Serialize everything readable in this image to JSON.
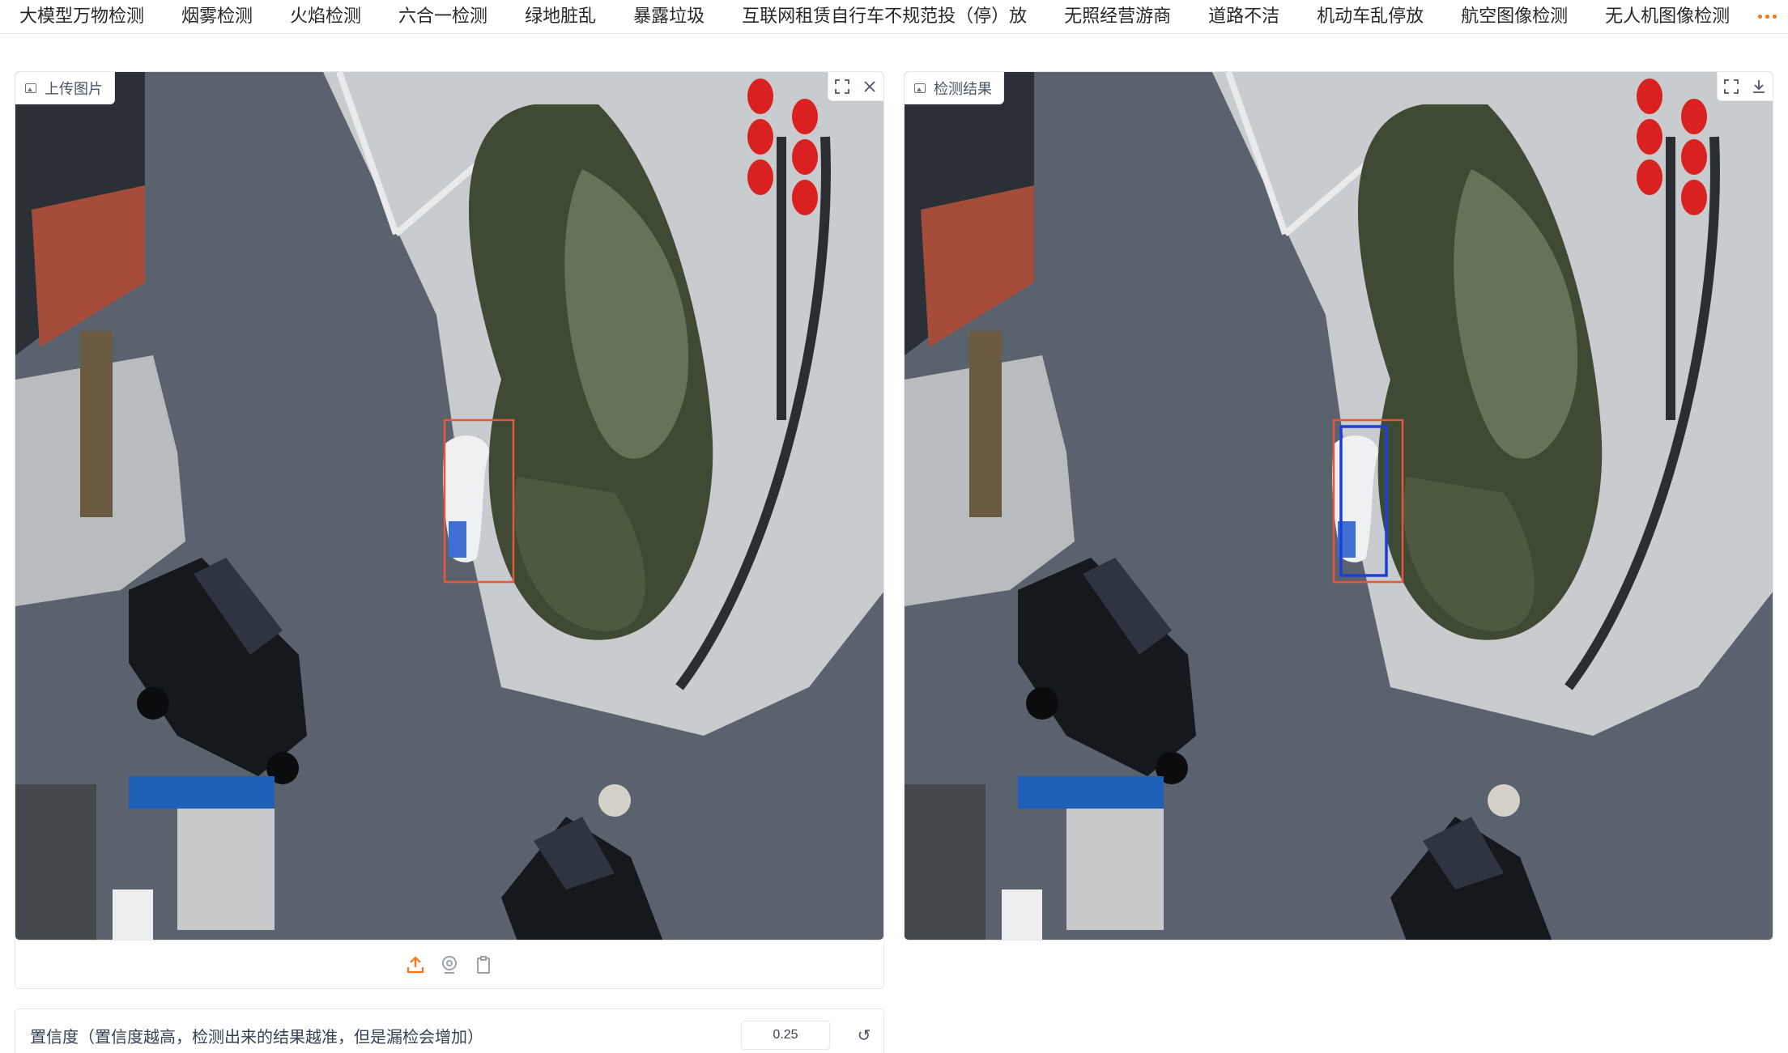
{
  "tabs": [
    {
      "label": "大模型万物检测"
    },
    {
      "label": "烟雾检测"
    },
    {
      "label": "火焰检测"
    },
    {
      "label": "六合一检测"
    },
    {
      "label": "绿地脏乱"
    },
    {
      "label": "暴露垃圾"
    },
    {
      "label": "互联网租赁自行车不规范投（停）放"
    },
    {
      "label": "无照经营游商"
    },
    {
      "label": "道路不洁"
    },
    {
      "label": "机动车乱停放"
    },
    {
      "label": "航空图像检测"
    },
    {
      "label": "无人机图像检测"
    }
  ],
  "more_icon": "ellipsis-icon",
  "input_panel": {
    "label": "上传图片",
    "badge_icon": "image-icon",
    "tools": [
      "fullscreen-icon",
      "close-icon"
    ],
    "box_color": "#e8573a"
  },
  "output_panel": {
    "label": "检测结果",
    "badge_icon": "image-icon",
    "tools": [
      "fullscreen-icon",
      "download-icon"
    ],
    "box_color": "#e8573a",
    "detect_color": "#1d3fd6"
  },
  "upload_bar": {
    "buttons": [
      "upload-icon",
      "webcam-icon",
      "clipboard-icon"
    ],
    "accent": "#f97316"
  },
  "confidence": {
    "label": "置信度（置信度越高，检测出来的结果越准，但是漏检会增加）",
    "value": "0.25",
    "reset_glyph": "↺"
  }
}
